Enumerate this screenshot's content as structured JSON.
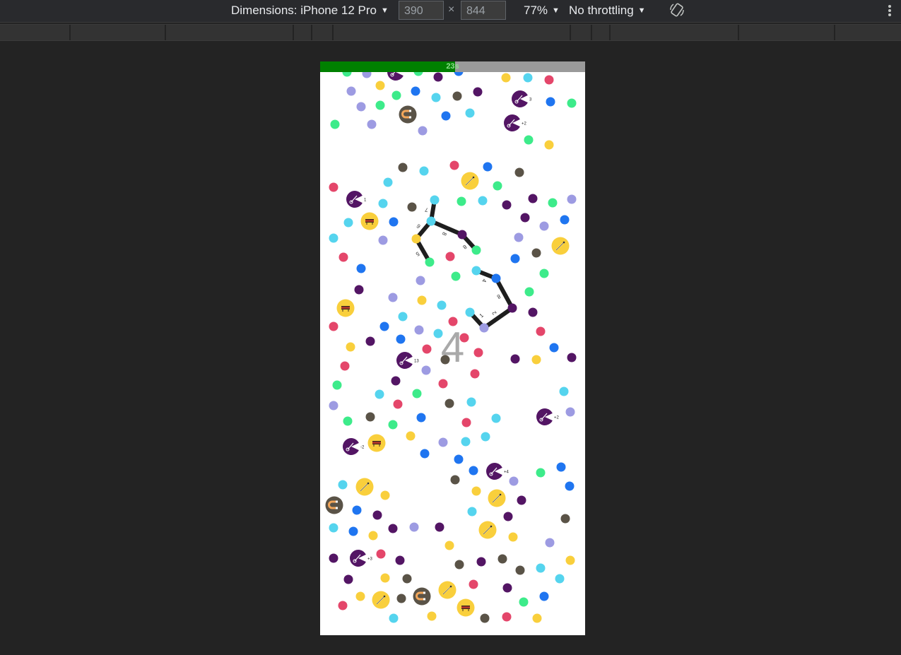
{
  "devtools": {
    "device_label": "Dimensions: iPhone 12 Pro",
    "width": "390",
    "times": "×",
    "height": "844",
    "zoom": "77%",
    "throttling": "No throttling",
    "icons": [
      "caret-down-icon",
      "rotate-icon",
      "more-vert-icon"
    ]
  },
  "game": {
    "timer_text": "23s",
    "timer_fraction": 0.51,
    "chain_count": "4",
    "colors": {
      "red": "#e4466a",
      "yellow": "#f9cf3c",
      "lightblue": "#55d4ee",
      "blue": "#1f75f0",
      "purple": "#531564",
      "lavender": "#9d9be2",
      "green": "#3deb8a",
      "gray": "#5a5347",
      "timer_green": "#008000",
      "timer_gray": "#9a9a9a",
      "link": "#1e1e1e"
    },
    "chain_labels": [
      "7",
      "8",
      "8",
      "6",
      "5",
      "4",
      "8",
      "2",
      "1"
    ],
    "badge_labels": [
      "3",
      "+2",
      "1",
      "13",
      "+2",
      "-2",
      "+4",
      "+3"
    ],
    "powerup_icons": [
      "music-note-icon",
      "dynamite-icon",
      "hook-icon",
      "magnet-icon"
    ]
  }
}
